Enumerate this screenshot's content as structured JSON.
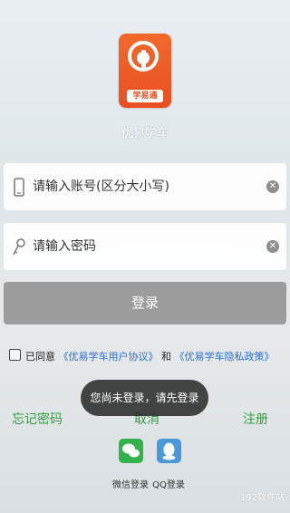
{
  "app": {
    "name": "优易学车",
    "logo_badge": "学易通"
  },
  "account_field": {
    "placeholder": "请输入账号(区分大小写)",
    "icon": "phone-icon",
    "clear_icon": "clear-icon"
  },
  "password_field": {
    "placeholder": "请输入密码",
    "icon": "key-icon",
    "clear_icon": "clear-icon"
  },
  "login_button": {
    "label": "登录"
  },
  "agreement": {
    "prefix": "已同意",
    "user_agreement": "《优易学车用户协议》",
    "and": "和",
    "privacy_policy": "《优易学车隐私政策》"
  },
  "actions": {
    "forgot_password": "忘记密码",
    "cancel": "取消",
    "register": "注册"
  },
  "toast": {
    "message": "您尚未登录，请先登录"
  },
  "social_login": [
    {
      "label": "微信登录",
      "icon": "wechat-icon"
    },
    {
      "label": "QQ登录",
      "icon": "qq-icon"
    }
  ],
  "watermark": "192软件站",
  "colors": {
    "accent_green": "#2da23b",
    "link_blue": "#2a6fd6",
    "logo_orange": "#ea4f22",
    "button_gray": "#9c9c9c"
  }
}
